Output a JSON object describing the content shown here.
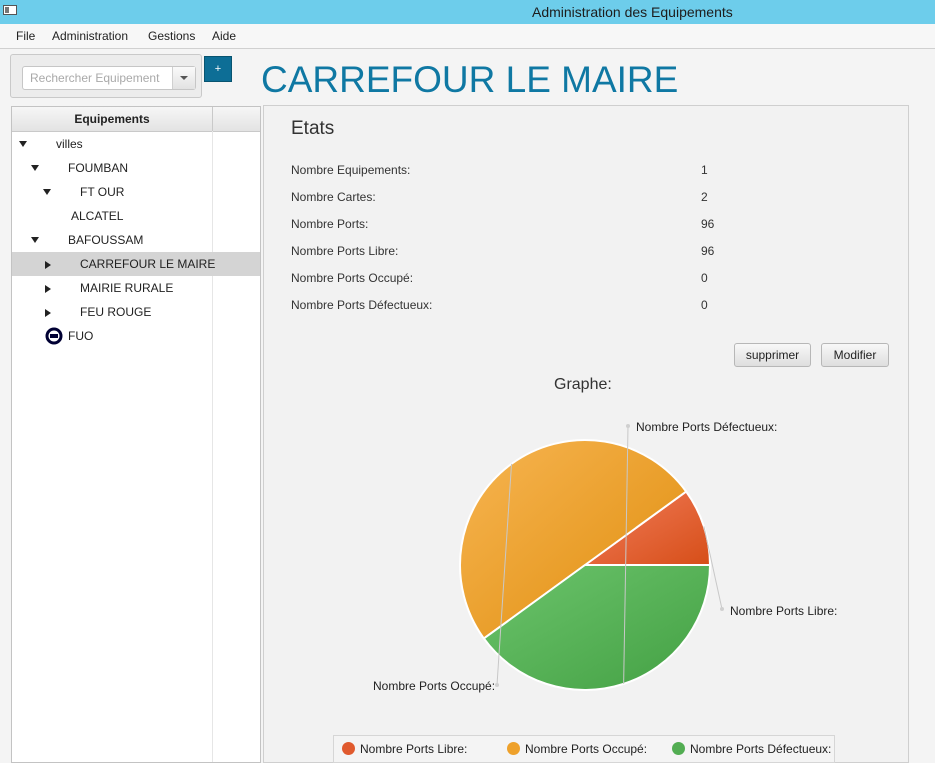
{
  "window": {
    "title": "Administration des Equipements"
  },
  "menu": [
    "File",
    "Administration",
    "Gestions",
    "Aide"
  ],
  "search": {
    "placeholder": "Rechercher Equipement"
  },
  "add_button_label": "+",
  "page_title": "CARREFOUR LE MAIRE",
  "tree": {
    "header": "Equipements",
    "nodes": [
      {
        "label": "villes"
      },
      {
        "label": "FOUMBAN"
      },
      {
        "label": "FT OUR"
      },
      {
        "label": "ALCATEL"
      },
      {
        "label": "BAFOUSSAM"
      },
      {
        "label": "CARREFOUR LE MAIRE"
      },
      {
        "label": "MAIRIE RURALE"
      },
      {
        "label": "FEU ROUGE"
      },
      {
        "label": "FUO"
      }
    ]
  },
  "etats": {
    "title": "Etats",
    "stats": [
      {
        "label": "Nombre Equipements:",
        "value": "1"
      },
      {
        "label": "Nombre Cartes:",
        "value": "2"
      },
      {
        "label": "Nombre Ports:",
        "value": "96"
      },
      {
        "label": "Nombre Ports Libre:",
        "value": "96"
      },
      {
        "label": "Nombre Ports Occupé:",
        "value": "0"
      },
      {
        "label": "Nombre Ports Défectueux:",
        "value": "0"
      }
    ]
  },
  "buttons": {
    "supprimer": "supprimer",
    "modifier": "Modifier"
  },
  "chart_data": {
    "type": "pie",
    "title": "Graphe:",
    "slices": [
      {
        "label": "Nombre Ports Libre:",
        "value": 10,
        "color": "#e8623a"
      },
      {
        "label": "Nombre Ports Occupé:",
        "value": 50,
        "color": "#efa62e"
      },
      {
        "label": "Nombre Ports Défectueux:",
        "value": 40,
        "color": "#5bb55b"
      }
    ],
    "legend": "bottom"
  },
  "colors": {
    "titlebar": "#6dcdeb",
    "accent": "#0f78a3"
  }
}
